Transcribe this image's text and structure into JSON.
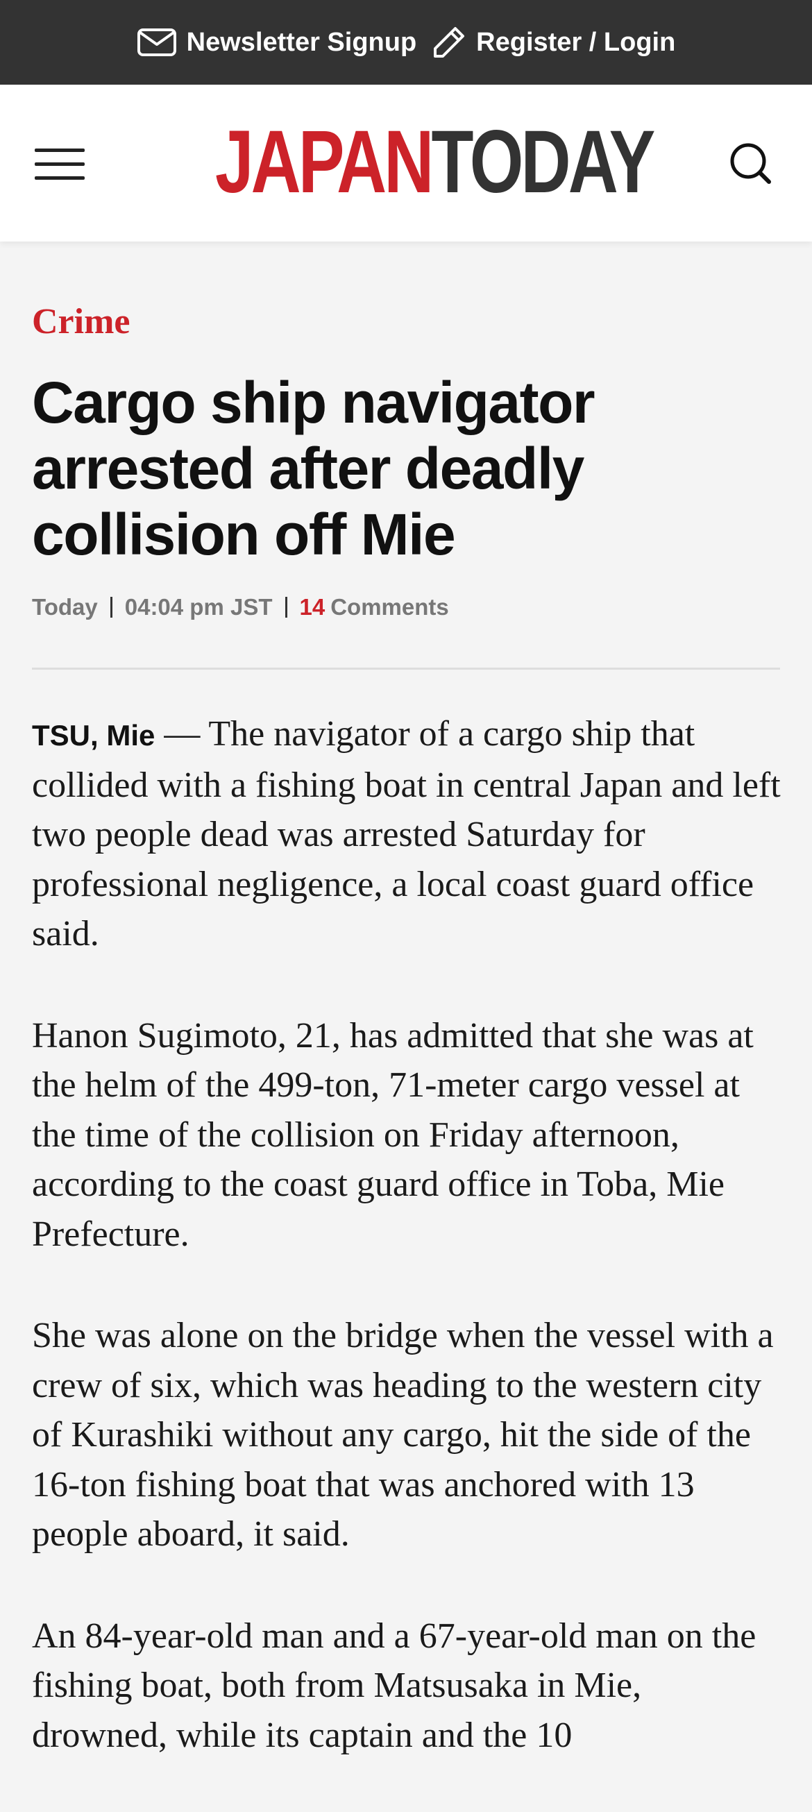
{
  "topbar": {
    "newsletter_label": "Newsletter Signup",
    "register_label": "Register / Login",
    "newsletter_icon": "envelope-icon",
    "register_icon": "pencil-icon"
  },
  "header": {
    "logo_part1": "JAPAN",
    "logo_part2": "TODAY",
    "menu_icon": "hamburger-menu-icon",
    "search_icon": "search-icon"
  },
  "colors": {
    "brand_red": "#cc2229",
    "topbar_bg": "#333333",
    "page_bg": "#f4f4f4"
  },
  "article": {
    "category": "Crime",
    "headline": "Cargo ship navigator arrested after deadly collision off Mie",
    "meta": {
      "date": "Today",
      "time": "04:04 pm JST",
      "comment_count": "14",
      "comments_label": "Comments"
    },
    "dateline": "TSU, Mie",
    "dash": " — ",
    "paragraphs": [
      "The navigator of a cargo ship that collided with a fishing boat in central Japan and left two people dead was arrested Saturday for professional negligence, a local coast guard office said.",
      "Hanon Sugimoto, 21, has admitted that she was at the helm of the 499-ton, 71-meter cargo vessel at the time of the collision on Friday afternoon, according to the coast guard office in Toba, Mie Prefecture.",
      "She was alone on the bridge when the vessel with a crew of six, which was heading to the western city of Kurashiki without any cargo, hit the side of the 16-ton fishing boat that was anchored with 13 people aboard, it said.",
      "An 84-year-old man and a 67-year-old man on the fishing boat, both from Matsusaka in Mie, drowned, while its captain and the 10"
    ]
  }
}
